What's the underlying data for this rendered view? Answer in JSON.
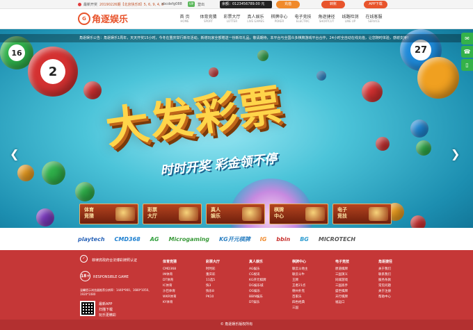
{
  "topbar": {
    "mq_label": "最新开奖",
    "mq_text": "20190226期【北京快乐8】5, 6, 9, 4, 8",
    "account": "abcdefg088",
    "vip": "VIP",
    "logout": "登出",
    "balance": "余额：0123456789.00 元",
    "btn1": "充值",
    "btn2": "转账",
    "btn3": "APP下载"
  },
  "logo": {
    "mark": "G",
    "text": "角逐娱乐"
  },
  "nav": [
    {
      "zh": "首 页",
      "en": "HOME"
    },
    {
      "zh": "体育竞猜",
      "en": "SPORT"
    },
    {
      "zh": "彩票大厅",
      "en": "LOTTER"
    },
    {
      "zh": "真人娱乐",
      "en": "LIVE GAMES"
    },
    {
      "zh": "棋牌中心",
      "en": "POKER"
    },
    {
      "zh": "电子竞技",
      "en": "ELECTRIC"
    },
    {
      "zh": "角逐捷径",
      "en": "SHORTCUT"
    },
    {
      "zh": "线路检测",
      "en": "LINE UP"
    },
    {
      "zh": "在线客服",
      "en": "SERVICE"
    }
  ],
  "notice": "角逐娱乐公告：角逐娱乐1周年，天天开奖15小时，今冬在重庆举行新年活动，新增玩家全部赠送一份新年礼品，敬请期待，本平台与全国众多棋牌游戏平台合作，24小时全自动在线充值，让您随时体验，感谢支持！",
  "banner": {
    "title": "大发彩票",
    "subtitle": "时时开奖 彩金领不停"
  },
  "categories": [
    {
      "l1": "体育",
      "l2": "竞猜"
    },
    {
      "l1": "彩票",
      "l2": "大厅"
    },
    {
      "l1": "真人",
      "l2": "娱乐"
    },
    {
      "l1": "棋牌",
      "l2": "中心"
    },
    {
      "l1": "电子",
      "l2": "竞技"
    }
  ],
  "partners": [
    "playtech",
    "CMD368",
    "AG",
    "Microgaming",
    "KG开元棋牌",
    "IG",
    "bbin",
    "BG",
    "MICROTECH"
  ],
  "footer": {
    "cert_icon": "✓",
    "cert": "菲律宾政府合法博彩牌照认证",
    "age": "18+",
    "responsible": "RESPONSIBLE GAME",
    "res_note": "温馨提示浏览器推荐分辨率：1440*900、1680*1050、1920*1080",
    "app1": "最新APP",
    "app2": "扫描下载",
    "app3": "玩乐更精彩",
    "cols": [
      {
        "h": "体育竞猜",
        "items": [
          "CMD368",
          "IM体育",
          "DT体育",
          "IC体育",
          "沙巴体育",
          "WKR体育",
          "KY体育"
        ]
      },
      {
        "h": "彩票大厅",
        "items": [
          "时时彩",
          "重庆彩",
          "11选5",
          "快3",
          "快乐8",
          "PK10"
        ]
      },
      {
        "h": "真人娱乐",
        "items": [
          "AG娱乐",
          "CG视讯",
          "KG开元棋牌",
          "DG娱乐城",
          "OG娱乐",
          "BBIN娱乐",
          "DT娱乐"
        ]
      },
      {
        "h": "棋牌中心",
        "items": [
          "联云斗地主",
          "联云斗牛",
          "王牌",
          "王者21点",
          "德州扑克",
          "百家乐",
          "四色经典",
          "三国"
        ]
      },
      {
        "h": "电子竞技",
        "items": [
          "原道棋牌",
          "三国演义",
          "同城游戏",
          "三国高手",
          "盛世棋牌",
          "天行棋牌",
          "福运口"
        ]
      },
      {
        "h": "角逐捷径",
        "items": [
          "关于我们",
          "联系我们",
          "服务条款",
          "常见问题",
          "关于注册",
          "帮助中心"
        ]
      }
    ]
  },
  "copyright": "© 角逐娱乐版权所有",
  "colors": {
    "brand": "#e8542c",
    "footer": "#c53737",
    "accent_green": "#34b24a"
  }
}
